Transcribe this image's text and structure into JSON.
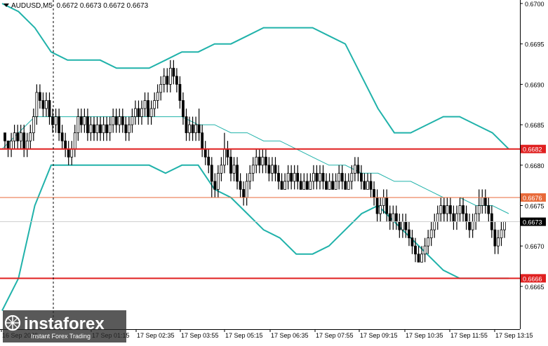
{
  "header": {
    "symbol": "AUDUSD,M5",
    "ohlc": "0.6672 0.6673 0.6672 0.6673"
  },
  "logo": {
    "brand": "instaforex",
    "tagline": "Instant Forex Trading"
  },
  "colors": {
    "bars": "#000000",
    "bollinger": "#20b2aa",
    "level_line": "#e02020",
    "level_line_thin": "#e86a3a",
    "level_label_bg": "#e02020",
    "current_label_bg": "#000000",
    "grid": "#d9d9d9"
  },
  "chart_data": {
    "type": "candlestick",
    "title": "AUDUSD,M5",
    "ylim": [
      0.6661,
      0.67
    ],
    "y_ticks": [
      "0.6700",
      "0.6695",
      "0.6690",
      "0.6685",
      "0.6680",
      "0.6675",
      "0.6670",
      "0.6665"
    ],
    "x_ticks": [
      "16 Sep 2020",
      "17 Sep 01:15",
      "17 Sep 02:35",
      "17 Sep 03:55",
      "17 Sep 05:15",
      "17 Sep 06:35",
      "17 Sep 07:55",
      "17 Sep 09:15",
      "17 Sep 10:35",
      "17 Sep 11:55",
      "17 Sep 13:15"
    ],
    "levels": [
      {
        "value": 0.6682,
        "label": "0.6682",
        "style": "thick"
      },
      {
        "value": 0.6676,
        "label": "0.6676",
        "style": "thin"
      },
      {
        "value": 0.6666,
        "label": "0.6666",
        "style": "thick"
      }
    ],
    "current_price": {
      "value": 0.6673,
      "label": "0.6673"
    },
    "bollinger": {
      "upper": [
        0.67,
        0.6699,
        0.6697,
        0.6694,
        0.6693,
        0.6693,
        0.6693,
        0.6692,
        0.6692,
        0.6692,
        0.6693,
        0.6694,
        0.6694,
        0.6695,
        0.6695,
        0.6696,
        0.6697,
        0.6697,
        0.6697,
        0.6697,
        0.6696,
        0.6695,
        0.6691,
        0.6687,
        0.6684,
        0.6684,
        0.6685,
        0.6686,
        0.6686,
        0.6685,
        0.6684,
        0.6682
      ],
      "middle": [
        0.6682,
        0.6684,
        0.6686,
        0.6686,
        0.6686,
        0.6686,
        0.6686,
        0.6686,
        0.6686,
        0.6686,
        0.6686,
        0.6686,
        0.6685,
        0.6685,
        0.6684,
        0.6684,
        0.6683,
        0.6683,
        0.6682,
        0.6681,
        0.668,
        0.668,
        0.6679,
        0.6679,
        0.6678,
        0.6678,
        0.6677,
        0.6676,
        0.6676,
        0.6675,
        0.6675,
        0.6674
      ],
      "lower": [
        0.6662,
        0.6666,
        0.6675,
        0.668,
        0.668,
        0.668,
        0.668,
        0.668,
        0.668,
        0.668,
        0.6679,
        0.668,
        0.668,
        0.6677,
        0.6676,
        0.6674,
        0.6672,
        0.6671,
        0.6669,
        0.6669,
        0.667,
        0.6672,
        0.6674,
        0.6675,
        0.6673,
        0.6671,
        0.6669,
        0.6667,
        0.6666,
        0.6666,
        0.6666,
        0.6666
      ]
    },
    "bars": [
      [
        0.6684,
        0.6683,
        0.6684,
        0.6682
      ],
      [
        0.6683,
        0.6682,
        0.6683,
        0.6681
      ],
      [
        0.6682,
        0.6683,
        0.6684,
        0.6681
      ],
      [
        0.6683,
        0.6684,
        0.6685,
        0.6682
      ],
      [
        0.6684,
        0.6683,
        0.6685,
        0.6682
      ],
      [
        0.6683,
        0.6684,
        0.6685,
        0.6682
      ],
      [
        0.6684,
        0.6682,
        0.6685,
        0.6681
      ],
      [
        0.6682,
        0.6683,
        0.6684,
        0.6681
      ],
      [
        0.6683,
        0.6684,
        0.6685,
        0.6682
      ],
      [
        0.6684,
        0.6686,
        0.6687,
        0.6683
      ],
      [
        0.6686,
        0.6689,
        0.669,
        0.6685
      ],
      [
        0.6689,
        0.6688,
        0.669,
        0.6687
      ],
      [
        0.6688,
        0.6687,
        0.6689,
        0.6686
      ],
      [
        0.6687,
        0.6688,
        0.6689,
        0.6686
      ],
      [
        0.6688,
        0.6686,
        0.6689,
        0.6685
      ],
      [
        0.6686,
        0.6685,
        0.6687,
        0.6684
      ],
      [
        0.6685,
        0.6686,
        0.6687,
        0.6684
      ],
      [
        0.6686,
        0.6684,
        0.6687,
        0.6683
      ],
      [
        0.6684,
        0.6683,
        0.6685,
        0.6682
      ],
      [
        0.6683,
        0.6682,
        0.6684,
        0.6681
      ],
      [
        0.6682,
        0.6681,
        0.6683,
        0.668
      ],
      [
        0.6681,
        0.6682,
        0.6683,
        0.668
      ],
      [
        0.6682,
        0.6684,
        0.6685,
        0.6681
      ],
      [
        0.6684,
        0.6686,
        0.6687,
        0.6683
      ],
      [
        0.6686,
        0.6685,
        0.6687,
        0.6684
      ],
      [
        0.6685,
        0.6686,
        0.6687,
        0.6684
      ],
      [
        0.6686,
        0.6684,
        0.6687,
        0.6683
      ],
      [
        0.6684,
        0.6685,
        0.6686,
        0.6683
      ],
      [
        0.6685,
        0.6684,
        0.6686,
        0.6683
      ],
      [
        0.6684,
        0.6685,
        0.6686,
        0.6683
      ],
      [
        0.6685,
        0.6684,
        0.6686,
        0.6683
      ],
      [
        0.6684,
        0.6685,
        0.6686,
        0.6683
      ],
      [
        0.6685,
        0.6684,
        0.6686,
        0.6683
      ],
      [
        0.6684,
        0.6685,
        0.6686,
        0.6683
      ],
      [
        0.6685,
        0.6686,
        0.6687,
        0.6684
      ],
      [
        0.6686,
        0.6685,
        0.6687,
        0.6684
      ],
      [
        0.6685,
        0.6686,
        0.6687,
        0.6684
      ],
      [
        0.6686,
        0.6685,
        0.6687,
        0.6684
      ],
      [
        0.6685,
        0.6684,
        0.6686,
        0.6683
      ],
      [
        0.6684,
        0.6685,
        0.6686,
        0.6683
      ],
      [
        0.6685,
        0.6686,
        0.6687,
        0.6684
      ],
      [
        0.6686,
        0.6687,
        0.6688,
        0.6685
      ],
      [
        0.6687,
        0.6686,
        0.6688,
        0.6685
      ],
      [
        0.6686,
        0.6687,
        0.6688,
        0.6685
      ],
      [
        0.6687,
        0.6688,
        0.6689,
        0.6686
      ],
      [
        0.6688,
        0.6686,
        0.6689,
        0.6685
      ],
      [
        0.6686,
        0.6687,
        0.6688,
        0.6685
      ],
      [
        0.6687,
        0.6688,
        0.6689,
        0.6686
      ],
      [
        0.6688,
        0.6689,
        0.669,
        0.6687
      ],
      [
        0.6689,
        0.669,
        0.6691,
        0.6688
      ],
      [
        0.669,
        0.6691,
        0.6692,
        0.6689
      ],
      [
        0.6691,
        0.669,
        0.6692,
        0.6689
      ],
      [
        0.669,
        0.6692,
        0.6693,
        0.6689
      ],
      [
        0.6692,
        0.6691,
        0.6693,
        0.669
      ],
      [
        0.6691,
        0.669,
        0.6692,
        0.6689
      ],
      [
        0.669,
        0.6688,
        0.6691,
        0.6687
      ],
      [
        0.6688,
        0.6686,
        0.6689,
        0.6685
      ],
      [
        0.6686,
        0.6684,
        0.6687,
        0.6683
      ],
      [
        0.6684,
        0.6685,
        0.6686,
        0.6683
      ],
      [
        0.6685,
        0.6684,
        0.6686,
        0.6683
      ],
      [
        0.6684,
        0.6685,
        0.6686,
        0.6683
      ],
      [
        0.6685,
        0.6684,
        0.6687,
        0.6683
      ],
      [
        0.6684,
        0.6682,
        0.6685,
        0.6681
      ],
      [
        0.6682,
        0.6681,
        0.6683,
        0.668
      ],
      [
        0.6681,
        0.668,
        0.6682,
        0.6679
      ],
      [
        0.668,
        0.6678,
        0.6681,
        0.6676
      ],
      [
        0.6678,
        0.6677,
        0.6679,
        0.6676
      ],
      [
        0.6677,
        0.6679,
        0.668,
        0.6676
      ],
      [
        0.6679,
        0.668,
        0.6681,
        0.6678
      ],
      [
        0.668,
        0.6682,
        0.6684,
        0.6679
      ],
      [
        0.6682,
        0.6681,
        0.6683,
        0.668
      ],
      [
        0.6681,
        0.6679,
        0.6682,
        0.6678
      ],
      [
        0.6679,
        0.668,
        0.6681,
        0.6678
      ],
      [
        0.668,
        0.6678,
        0.6681,
        0.6677
      ],
      [
        0.6678,
        0.6677,
        0.6679,
        0.6676
      ],
      [
        0.6677,
        0.6676,
        0.6678,
        0.6675
      ],
      [
        0.6676,
        0.6678,
        0.6679,
        0.6675
      ],
      [
        0.6678,
        0.6679,
        0.668,
        0.6677
      ],
      [
        0.6679,
        0.668,
        0.6681,
        0.6678
      ],
      [
        0.668,
        0.6681,
        0.6682,
        0.6679
      ],
      [
        0.6681,
        0.668,
        0.6682,
        0.6679
      ],
      [
        0.668,
        0.6681,
        0.6682,
        0.6679
      ],
      [
        0.6681,
        0.668,
        0.6682,
        0.6679
      ],
      [
        0.668,
        0.6679,
        0.6681,
        0.6678
      ],
      [
        0.6679,
        0.668,
        0.6681,
        0.6678
      ],
      [
        0.668,
        0.6679,
        0.6681,
        0.6678
      ],
      [
        0.6679,
        0.6678,
        0.668,
        0.6677
      ],
      [
        0.6678,
        0.6677,
        0.6679,
        0.6677
      ],
      [
        0.6677,
        0.6678,
        0.6679,
        0.6677
      ],
      [
        0.6678,
        0.6679,
        0.668,
        0.6677
      ],
      [
        0.6679,
        0.6678,
        0.668,
        0.6677
      ],
      [
        0.6678,
        0.6679,
        0.668,
        0.6677
      ],
      [
        0.6679,
        0.6678,
        0.668,
        0.6677
      ],
      [
        0.6678,
        0.6677,
        0.6679,
        0.6677
      ],
      [
        0.6677,
        0.6678,
        0.6679,
        0.6677
      ],
      [
        0.6678,
        0.6677,
        0.6679,
        0.6677
      ],
      [
        0.6677,
        0.6678,
        0.6679,
        0.6677
      ],
      [
        0.6678,
        0.6679,
        0.668,
        0.6677
      ],
      [
        0.6679,
        0.6678,
        0.668,
        0.6677
      ],
      [
        0.6678,
        0.6679,
        0.668,
        0.6677
      ],
      [
        0.6679,
        0.6678,
        0.668,
        0.6677
      ],
      [
        0.6678,
        0.6677,
        0.6679,
        0.6677
      ],
      [
        0.6677,
        0.6678,
        0.6679,
        0.6677
      ],
      [
        0.6678,
        0.6677,
        0.6679,
        0.6677
      ],
      [
        0.6677,
        0.6678,
        0.6679,
        0.6677
      ],
      [
        0.6678,
        0.6679,
        0.668,
        0.6677
      ],
      [
        0.6679,
        0.6678,
        0.668,
        0.6677
      ],
      [
        0.6678,
        0.6677,
        0.6679,
        0.6677
      ],
      [
        0.6677,
        0.6678,
        0.6679,
        0.6677
      ],
      [
        0.6678,
        0.6679,
        0.668,
        0.6677
      ],
      [
        0.6679,
        0.668,
        0.6681,
        0.6678
      ],
      [
        0.668,
        0.6679,
        0.6681,
        0.6678
      ],
      [
        0.6679,
        0.6678,
        0.668,
        0.6677
      ],
      [
        0.6678,
        0.6677,
        0.6679,
        0.6677
      ],
      [
        0.6677,
        0.6678,
        0.6679,
        0.6677
      ],
      [
        0.6678,
        0.6677,
        0.6679,
        0.6676
      ],
      [
        0.6677,
        0.6676,
        0.6678,
        0.6675
      ],
      [
        0.6676,
        0.6674,
        0.6677,
        0.6673
      ],
      [
        0.6674,
        0.6675,
        0.6676,
        0.6673
      ],
      [
        0.6675,
        0.6676,
        0.6677,
        0.6674
      ],
      [
        0.6676,
        0.6674,
        0.6677,
        0.6673
      ],
      [
        0.6674,
        0.6673,
        0.6675,
        0.6672
      ],
      [
        0.6673,
        0.6674,
        0.6675,
        0.6672
      ],
      [
        0.6674,
        0.6673,
        0.6675,
        0.6672
      ],
      [
        0.6673,
        0.6672,
        0.6674,
        0.6671
      ],
      [
        0.6672,
        0.6673,
        0.6674,
        0.6671
      ],
      [
        0.6673,
        0.6672,
        0.6674,
        0.6671
      ],
      [
        0.6672,
        0.6671,
        0.6673,
        0.667
      ],
      [
        0.6671,
        0.667,
        0.6672,
        0.6669
      ],
      [
        0.667,
        0.6669,
        0.6671,
        0.6668
      ],
      [
        0.6669,
        0.6668,
        0.667,
        0.6668
      ],
      [
        0.6668,
        0.6669,
        0.667,
        0.6668
      ],
      [
        0.6669,
        0.667,
        0.6671,
        0.6668
      ],
      [
        0.667,
        0.6671,
        0.6672,
        0.6669
      ],
      [
        0.6671,
        0.6672,
        0.6673,
        0.667
      ],
      [
        0.6672,
        0.6673,
        0.6674,
        0.6671
      ],
      [
        0.6673,
        0.6674,
        0.6675,
        0.6672
      ],
      [
        0.6674,
        0.6675,
        0.6676,
        0.6673
      ],
      [
        0.6675,
        0.6674,
        0.6676,
        0.6673
      ],
      [
        0.6674,
        0.6675,
        0.6676,
        0.6673
      ],
      [
        0.6675,
        0.6674,
        0.6676,
        0.6673
      ],
      [
        0.6674,
        0.6673,
        0.6675,
        0.6672
      ],
      [
        0.6673,
        0.6674,
        0.6675,
        0.6672
      ],
      [
        0.6674,
        0.6675,
        0.6676,
        0.6673
      ],
      [
        0.6675,
        0.6674,
        0.6676,
        0.6673
      ],
      [
        0.6674,
        0.6673,
        0.6675,
        0.6672
      ],
      [
        0.6673,
        0.6672,
        0.6674,
        0.6671
      ],
      [
        0.6672,
        0.6673,
        0.6674,
        0.6671
      ],
      [
        0.6673,
        0.6674,
        0.6675,
        0.6672
      ],
      [
        0.6674,
        0.6675,
        0.6677,
        0.6673
      ],
      [
        0.6675,
        0.6676,
        0.6677,
        0.6674
      ],
      [
        0.6676,
        0.6675,
        0.6677,
        0.6674
      ],
      [
        0.6675,
        0.6674,
        0.6676,
        0.6673
      ],
      [
        0.6674,
        0.6672,
        0.6675,
        0.6671
      ],
      [
        0.6672,
        0.667,
        0.6673,
        0.6669
      ],
      [
        0.667,
        0.6671,
        0.6672,
        0.6669
      ],
      [
        0.6671,
        0.6672,
        0.6673,
        0.667
      ],
      [
        0.6672,
        0.6673,
        0.6673,
        0.6671
      ]
    ]
  }
}
